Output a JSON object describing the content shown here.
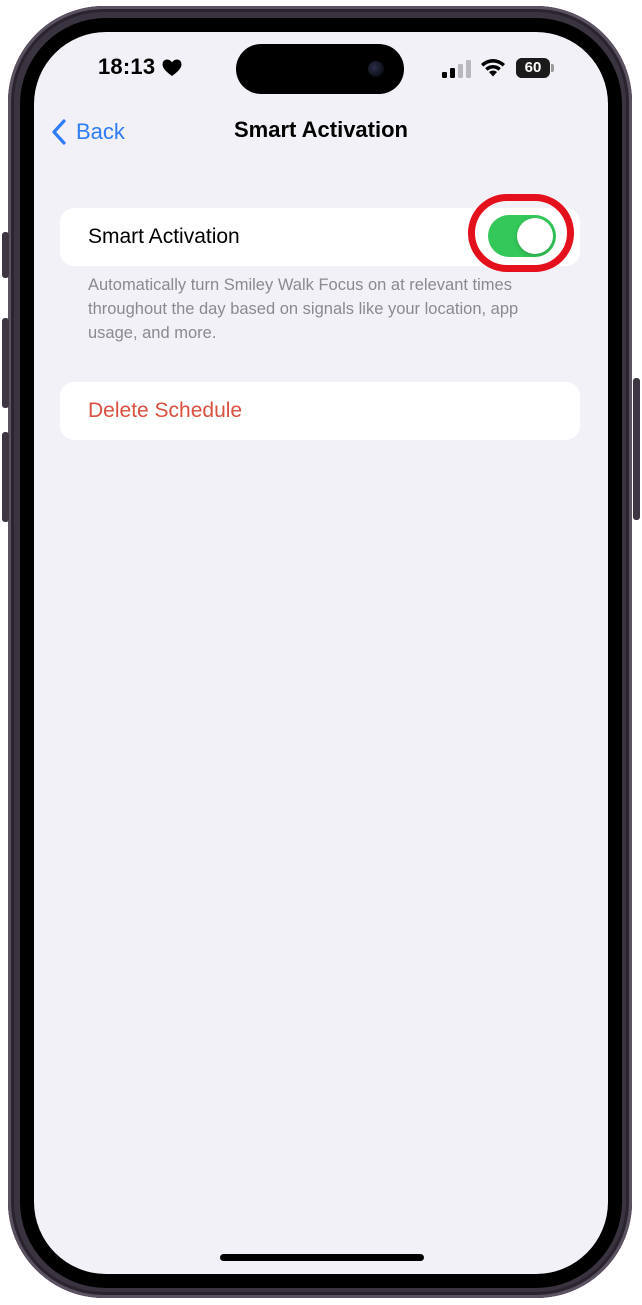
{
  "status_bar": {
    "time": "18:13",
    "battery": "60",
    "heart_icon": "heart-icon",
    "signal_icon": "cellular-signal-icon",
    "wifi_icon": "wifi-icon",
    "battery_icon": "battery-icon",
    "battery_level": 0.6
  },
  "nav": {
    "back_label": "Back",
    "back_icon": "chevron-left-icon",
    "title": "Smart Activation"
  },
  "smart_activation": {
    "label": "Smart Activation",
    "toggle_on": true,
    "footer": "Automatically turn Smiley Walk Focus on at relevant times throughout the day based on signals like your location, app usage, and more."
  },
  "delete_schedule": {
    "label": "Delete Schedule"
  },
  "colors": {
    "accent_blue": "#2f7cf6",
    "toggle_green": "#34c759",
    "destructive_red": "#d9503f",
    "highlight_red": "#e4101b",
    "background": "#f2f1f7"
  }
}
